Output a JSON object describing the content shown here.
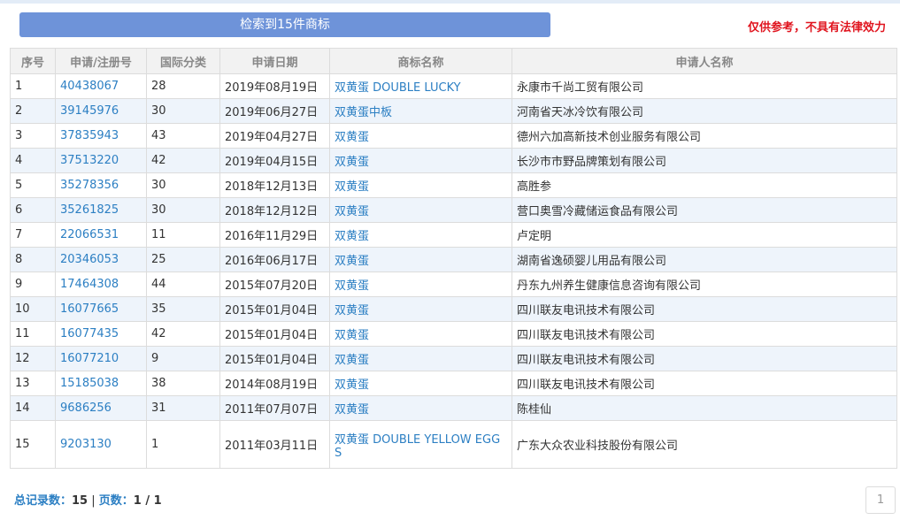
{
  "search_banner": "检索到15件商标",
  "disclaimer": "仅供参考，不具有法律效力",
  "columns": [
    "序号",
    "申请/注册号",
    "国际分类",
    "申请日期",
    "商标名称",
    "申请人名称"
  ],
  "rows": [
    {
      "no": "1",
      "reg": "40438067",
      "cls": "28",
      "date": "2019年08月19日",
      "name": "双黄蛋 DOUBLE LUCKY",
      "applicant": "永康市千尚工贸有限公司"
    },
    {
      "no": "2",
      "reg": "39145976",
      "cls": "30",
      "date": "2019年06月27日",
      "name": "双黄蛋中板",
      "applicant": "河南省天冰冷饮有限公司"
    },
    {
      "no": "3",
      "reg": "37835943",
      "cls": "43",
      "date": "2019年04月27日",
      "name": "双黄蛋",
      "applicant": "德州六加高新技术创业服务有限公司"
    },
    {
      "no": "4",
      "reg": "37513220",
      "cls": "42",
      "date": "2019年04月15日",
      "name": "双黄蛋",
      "applicant": "长沙市市野品牌策划有限公司"
    },
    {
      "no": "5",
      "reg": "35278356",
      "cls": "30",
      "date": "2018年12月13日",
      "name": "双黄蛋",
      "applicant": "高胜参"
    },
    {
      "no": "6",
      "reg": "35261825",
      "cls": "30",
      "date": "2018年12月12日",
      "name": "双黄蛋",
      "applicant": "营口奥雪冷藏储运食品有限公司"
    },
    {
      "no": "7",
      "reg": "22066531",
      "cls": "11",
      "date": "2016年11月29日",
      "name": "双黄蛋",
      "applicant": "卢定明"
    },
    {
      "no": "8",
      "reg": "20346053",
      "cls": "25",
      "date": "2016年06月17日",
      "name": "双黄蛋",
      "applicant": "湖南省逸硕婴儿用品有限公司"
    },
    {
      "no": "9",
      "reg": "17464308",
      "cls": "44",
      "date": "2015年07月20日",
      "name": "双黄蛋",
      "applicant": "丹东九州养生健康信息咨询有限公司"
    },
    {
      "no": "10",
      "reg": "16077665",
      "cls": "35",
      "date": "2015年01月04日",
      "name": "双黄蛋",
      "applicant": "四川联友电讯技术有限公司"
    },
    {
      "no": "11",
      "reg": "16077435",
      "cls": "42",
      "date": "2015年01月04日",
      "name": "双黄蛋",
      "applicant": "四川联友电讯技术有限公司"
    },
    {
      "no": "12",
      "reg": "16077210",
      "cls": "9",
      "date": "2015年01月04日",
      "name": "双黄蛋",
      "applicant": "四川联友电讯技术有限公司"
    },
    {
      "no": "13",
      "reg": "15185038",
      "cls": "38",
      "date": "2014年08月19日",
      "name": "双黄蛋",
      "applicant": "四川联友电讯技术有限公司"
    },
    {
      "no": "14",
      "reg": "9686256",
      "cls": "31",
      "date": "2011年07月07日",
      "name": "双黄蛋",
      "applicant": "陈桂仙"
    },
    {
      "no": "15",
      "reg": "9203130",
      "cls": "1",
      "date": "2011年03月11日",
      "name": "双黄蛋 DOUBLE YELLOW EGGS",
      "applicant": "广东大众农业科技股份有限公司"
    }
  ],
  "footer": {
    "total_label": "总记录数：",
    "total": "15",
    "sep": " | ",
    "pages_label": "页数：",
    "pages": "1 / 1"
  },
  "pager": {
    "current": "1"
  },
  "colors": {
    "accent": "#2c7fc3",
    "banner": "#6e93d9",
    "warning": "#e0141e",
    "row_alt": "#eef4fb"
  }
}
